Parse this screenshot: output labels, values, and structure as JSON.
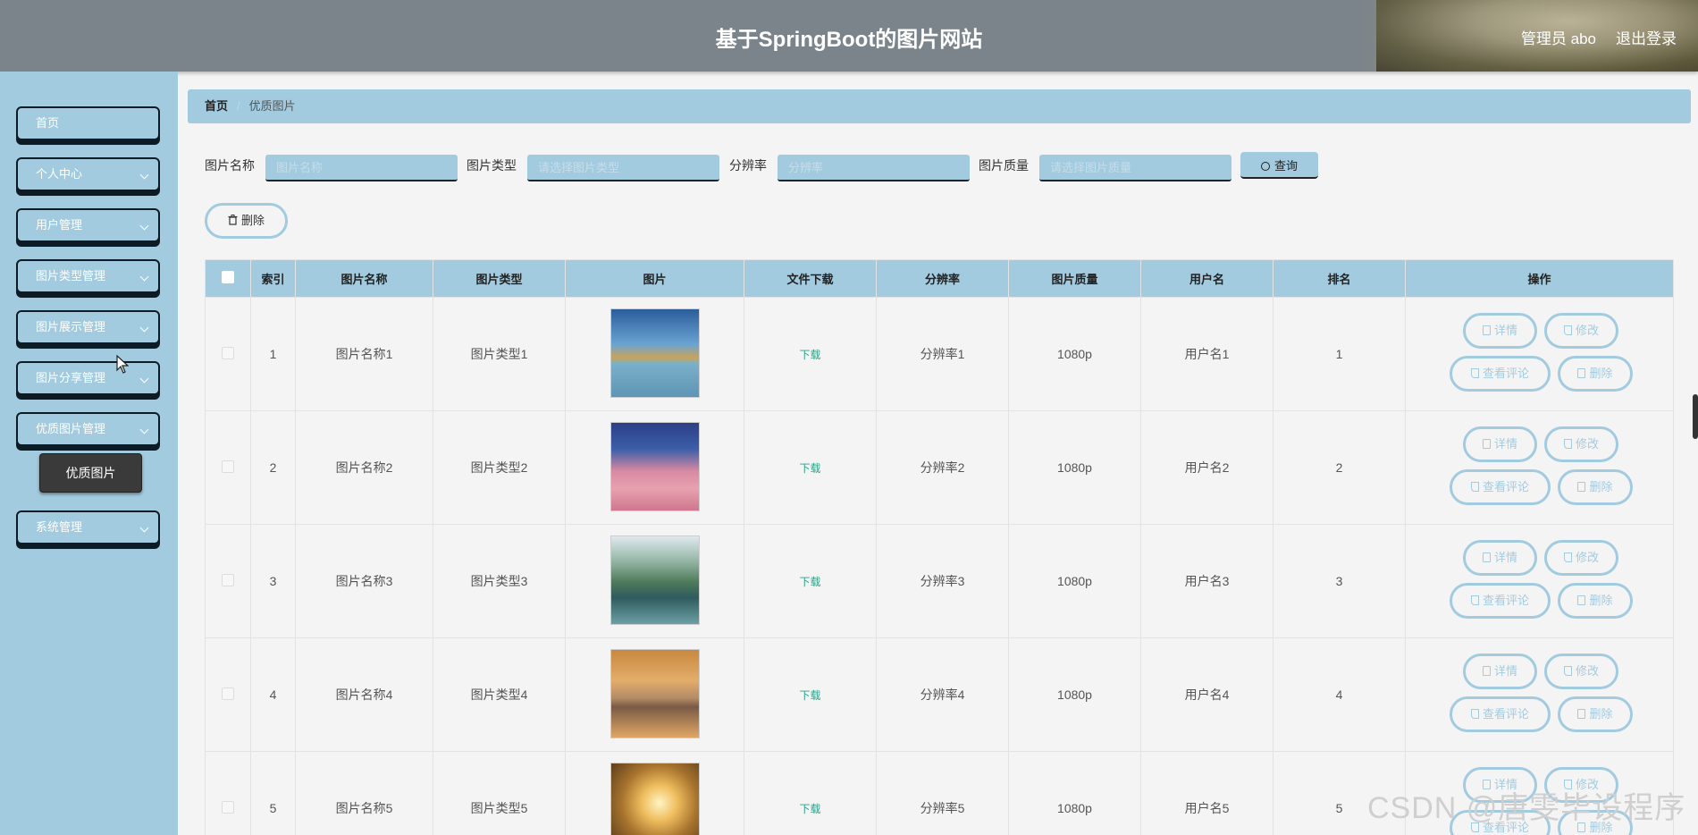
{
  "header": {
    "title": "基于SpringBoot的图片网站",
    "user": "管理员 abo",
    "logout": "退出登录"
  },
  "sidebar": {
    "items": [
      {
        "label": "首页",
        "chevron": false
      },
      {
        "label": "个人中心",
        "chevron": true
      },
      {
        "label": "用户管理",
        "chevron": true
      },
      {
        "label": "图片类型管理",
        "chevron": true
      },
      {
        "label": "图片展示管理",
        "chevron": true
      },
      {
        "label": "图片分享管理",
        "chevron": true
      },
      {
        "label": "优质图片管理",
        "chevron": true
      },
      {
        "label": "系统管理",
        "chevron": true
      }
    ],
    "submenu_active": "优质图片"
  },
  "breadcrumb": {
    "home": "首页",
    "separator": "/",
    "current": "优质图片"
  },
  "search": {
    "name_label": "图片名称",
    "name_placeholder": "图片名称",
    "type_label": "图片类型",
    "type_placeholder": "请选择图片类型",
    "res_label": "分辨率",
    "res_placeholder": "分辨率",
    "quality_label": "图片质量",
    "quality_placeholder": "请选择图片质量",
    "search_button": "查询"
  },
  "actions": {
    "delete_button": "删除"
  },
  "table": {
    "headers": [
      "索引",
      "图片名称",
      "图片类型",
      "图片",
      "文件下载",
      "分辨率",
      "图片质量",
      "用户名",
      "排名",
      "操作"
    ],
    "rows": [
      {
        "index": "1",
        "name": "图片名称1",
        "type": "图片类型1",
        "download": "下载",
        "resolution": "分辨率1",
        "quality": "1080p",
        "user": "用户名1",
        "rank": "1"
      },
      {
        "index": "2",
        "name": "图片名称2",
        "type": "图片类型2",
        "download": "下载",
        "resolution": "分辨率2",
        "quality": "1080p",
        "user": "用户名2",
        "rank": "2"
      },
      {
        "index": "3",
        "name": "图片名称3",
        "type": "图片类型3",
        "download": "下载",
        "resolution": "分辨率3",
        "quality": "1080p",
        "user": "用户名3",
        "rank": "3"
      },
      {
        "index": "4",
        "name": "图片名称4",
        "type": "图片类型4",
        "download": "下载",
        "resolution": "分辨率4",
        "quality": "1080p",
        "user": "用户名4",
        "rank": "4"
      },
      {
        "index": "5",
        "name": "图片名称5",
        "type": "图片类型5",
        "download": "下载",
        "resolution": "分辨率5",
        "quality": "1080p",
        "user": "用户名5",
        "rank": "5"
      }
    ],
    "row_buttons": {
      "detail": "详情",
      "edit": "修改",
      "comments": "查看评论",
      "delete": "删除"
    }
  },
  "watermark": "CSDN @唐雯毕设程序",
  "colors": {
    "accent": "#a2cbdf",
    "header": "#7b848b",
    "download_link": "#2aa58a",
    "submenu_active": "#3a3a3a"
  }
}
